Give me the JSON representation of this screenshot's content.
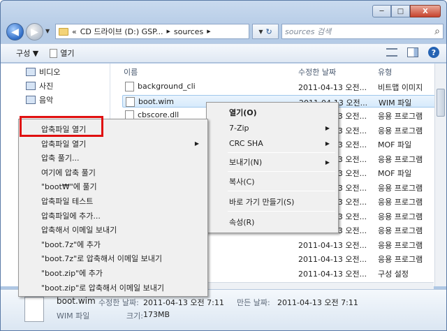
{
  "window": {
    "min": "─",
    "max": "□",
    "close": "X"
  },
  "nav": {
    "back": "◀",
    "forward": "▶",
    "dropdown": "▼"
  },
  "address": {
    "prefix": "«",
    "segments": [
      "CD 드라이브 (D:) GSP...",
      "sources"
    ],
    "sep": "▶",
    "refresh_arrow": "▼",
    "refresh": "↻"
  },
  "search": {
    "placeholder": "sources 검색",
    "icon": "⌕"
  },
  "toolbar": {
    "organize": "구성 ▼",
    "open": "열기"
  },
  "navpane": [
    "비디오",
    "사진",
    "음악"
  ],
  "columns": {
    "name": "이름",
    "date": "수정한 날짜",
    "type": "유형"
  },
  "files": [
    {
      "name": "background_cli",
      "date": "2011-04-13 오전...",
      "type": "비트맵 이미지"
    },
    {
      "name": "boot.wim",
      "date": "2011-04-13 오전...",
      "type": "WIM 파일"
    },
    {
      "name": "cbscore.dll",
      "date": "2011-04-13 오전...",
      "type": "응용 프로그램"
    },
    {
      "name": "",
      "date": "2011-04-13 오전...",
      "type": "응용 프로그램"
    },
    {
      "name": "",
      "date": "2011-04-13 오전...",
      "type": "MOF 파일"
    },
    {
      "name": "",
      "date": "2011-04-13 오전...",
      "type": "응용 프로그램"
    },
    {
      "name": "",
      "date": "2011-04-13 오전...",
      "type": "MOF 파일"
    },
    {
      "name": "",
      "date": "2011-04-13 오전...",
      "type": "응용 프로그램"
    },
    {
      "name": "",
      "date": "2011-04-13 오전...",
      "type": "응용 프로그램"
    },
    {
      "name": "",
      "date": "2011-04-13 오전...",
      "type": "응용 프로그램"
    },
    {
      "name": "",
      "date": "2011-04-13 오전...",
      "type": "응용 프로그램"
    },
    {
      "name": "",
      "date": "2011-04-13 오전...",
      "type": "응용 프로그램"
    },
    {
      "name": "",
      "date": "2011-04-13 오전...",
      "type": "응용 프로그램"
    },
    {
      "name": "",
      "date": "2011-04-13 오전...",
      "type": "구성 설정"
    },
    {
      "name": "",
      "date": "2011-04-13 오전...",
      "type": "응용 프로그램"
    }
  ],
  "details": {
    "name": "boot.wim",
    "modified_label": "수정한 날짜:",
    "modified": "2011-04-13 오전 7:11",
    "created_label": "만든 날짜:",
    "created": "2011-04-13 오전 7:11",
    "type": "WIM 파일",
    "size_label": "크기:",
    "size": "173MB"
  },
  "context_menu": [
    "열기(O)",
    "7-Zip",
    "CRC SHA",
    "보내기(N)",
    "복사(C)",
    "바로 가기 만들기(S)",
    "속성(R)"
  ],
  "submenu": [
    "압축파일 열기",
    "압축파일 열기",
    "압축 풀기...",
    "여기에 압축 풀기",
    "\"boot₩\"에 풀기",
    "압축파일 테스트",
    "압축파일에 추가...",
    "압축해서 이메일 보내기",
    "\"boot.7z\"에 추가",
    "\"boot.7z\"로 압축해서 이메일 보내기",
    "\"boot.zip\"에 추가",
    "\"boot.zip\"로 압축해서 이메일 보내기"
  ],
  "submenu_arrow": "▶",
  "colors": {
    "highlight": "#e01010",
    "selection": "#d6eafc"
  }
}
